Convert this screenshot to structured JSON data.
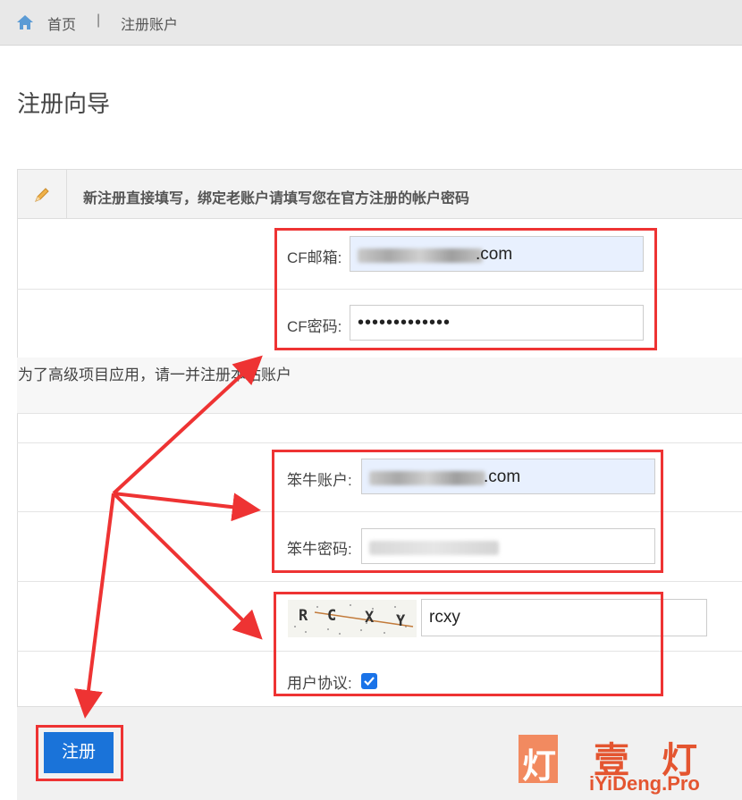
{
  "breadcrumb": {
    "home": "首页",
    "separator": "|",
    "current": "注册账户"
  },
  "page_title": "注册向导",
  "panel": {
    "note": "新注册直接填写，绑定老账户请填写您在官方注册的帐户密码"
  },
  "cf": {
    "email_label": "CF邮箱:",
    "email_value": ".com",
    "password_label": "CF密码:",
    "password_value": "•••••••••••••"
  },
  "section_text": "为了高级项目应用，请一并注册本站账户",
  "site": {
    "account_label": "笨牛账户:",
    "account_value": ".com",
    "password_label": "笨牛密码:"
  },
  "captcha": {
    "letters": [
      "R",
      "C",
      "X",
      "Y"
    ],
    "input_value": "rcxy"
  },
  "agreement": {
    "label": "用户协议:",
    "checked": true
  },
  "submit_label": "注册",
  "watermark": {
    "chars": [
      "灯",
      "壹",
      "灯"
    ],
    "url": "iYiDeng.Pro"
  },
  "colors": {
    "accent": "#1a73d9",
    "highlight": "#ee3333",
    "watermark": "#e45530"
  }
}
